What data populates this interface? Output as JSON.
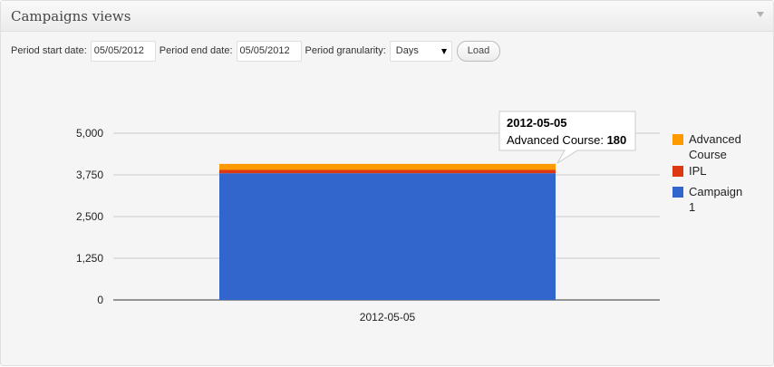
{
  "widget": {
    "title": "Campaigns views"
  },
  "controls": {
    "start_label": "Period start date:",
    "start_value": "05/05/2012",
    "end_label": "Period end date:",
    "end_value": "05/05/2012",
    "granularity_label": "Period granularity:",
    "granularity_value": "Days",
    "load_label": "Load"
  },
  "chart_data": {
    "type": "bar",
    "stacked": true,
    "categories": [
      "2012-05-05"
    ],
    "series": [
      {
        "name": "Advanced Course",
        "color": "#ff9900",
        "values": [
          180
        ]
      },
      {
        "name": "IPL",
        "color": "#dc3912",
        "values": [
          100
        ]
      },
      {
        "name": "Campaign 1",
        "color": "#3366cc",
        "values": [
          3800
        ]
      }
    ],
    "ylim": [
      0,
      5000
    ],
    "yticks": [
      "5,000",
      "3,750",
      "2,500",
      "1,250",
      "0"
    ],
    "ytick_values": [
      5000,
      3750,
      2500,
      1250,
      0
    ],
    "grid": true,
    "legend": "right",
    "legend_lines": [
      [
        "Advanced",
        "Course"
      ],
      [
        "IPL"
      ],
      [
        "Campaign",
        "1"
      ]
    ],
    "tooltip": {
      "title": "2012-05-05",
      "label": "Advanced Course:",
      "value": "180"
    }
  }
}
